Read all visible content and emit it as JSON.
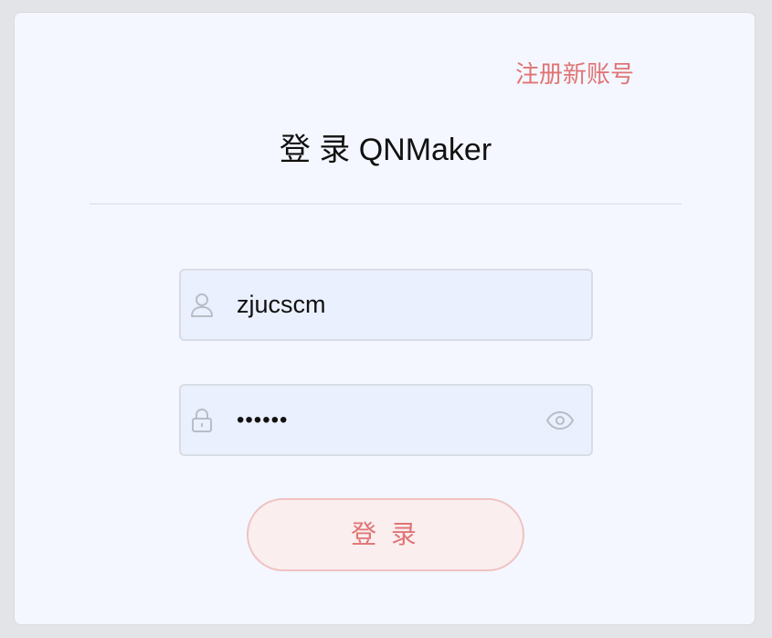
{
  "header": {
    "register_link": "注册新账号",
    "title": "登 录 QNMaker"
  },
  "form": {
    "username": {
      "value": "zjucscm",
      "icon": "user-icon"
    },
    "password": {
      "value": "••••••",
      "icon": "lock-icon",
      "toggle_icon": "eye-icon"
    },
    "submit_label": "登 录"
  },
  "colors": {
    "accent": "#e07474",
    "card_bg": "#f4f7ff",
    "field_bg": "#eaf0fd",
    "button_bg": "#faeeef"
  }
}
